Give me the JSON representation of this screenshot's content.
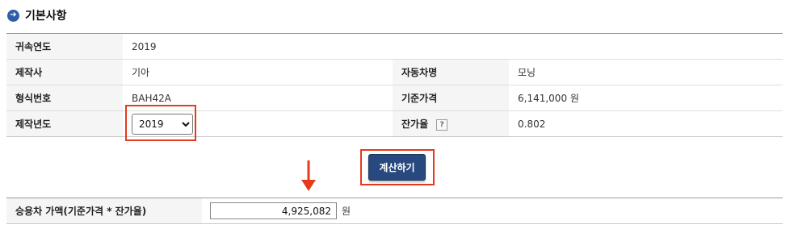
{
  "section": {
    "title": "기본사항",
    "icon": "arrow-right-circle-icon"
  },
  "basic": {
    "year_label": "귀속연도",
    "year_value": "2019",
    "maker_label": "제작사",
    "maker_value": "기아",
    "model_label": "자동차명",
    "model_value": "모닝",
    "type_label": "형식번호",
    "type_value": "BAH42A",
    "base_price_label": "기준가격",
    "base_price_value": "6,141,000 원",
    "made_year_label": "제작년도",
    "made_year_selected": "2019",
    "residual_label": "잔가율",
    "residual_help": "?",
    "residual_value": "0.802"
  },
  "actions": {
    "calculate_label": "계산하기"
  },
  "result": {
    "label": "승용차 가액(기준가격 * 잔가율)",
    "value": "4,925,082",
    "unit": "원"
  },
  "colors": {
    "accent": "#27497f",
    "highlight": "#e53a1c",
    "icon": "#2d5fa7"
  }
}
